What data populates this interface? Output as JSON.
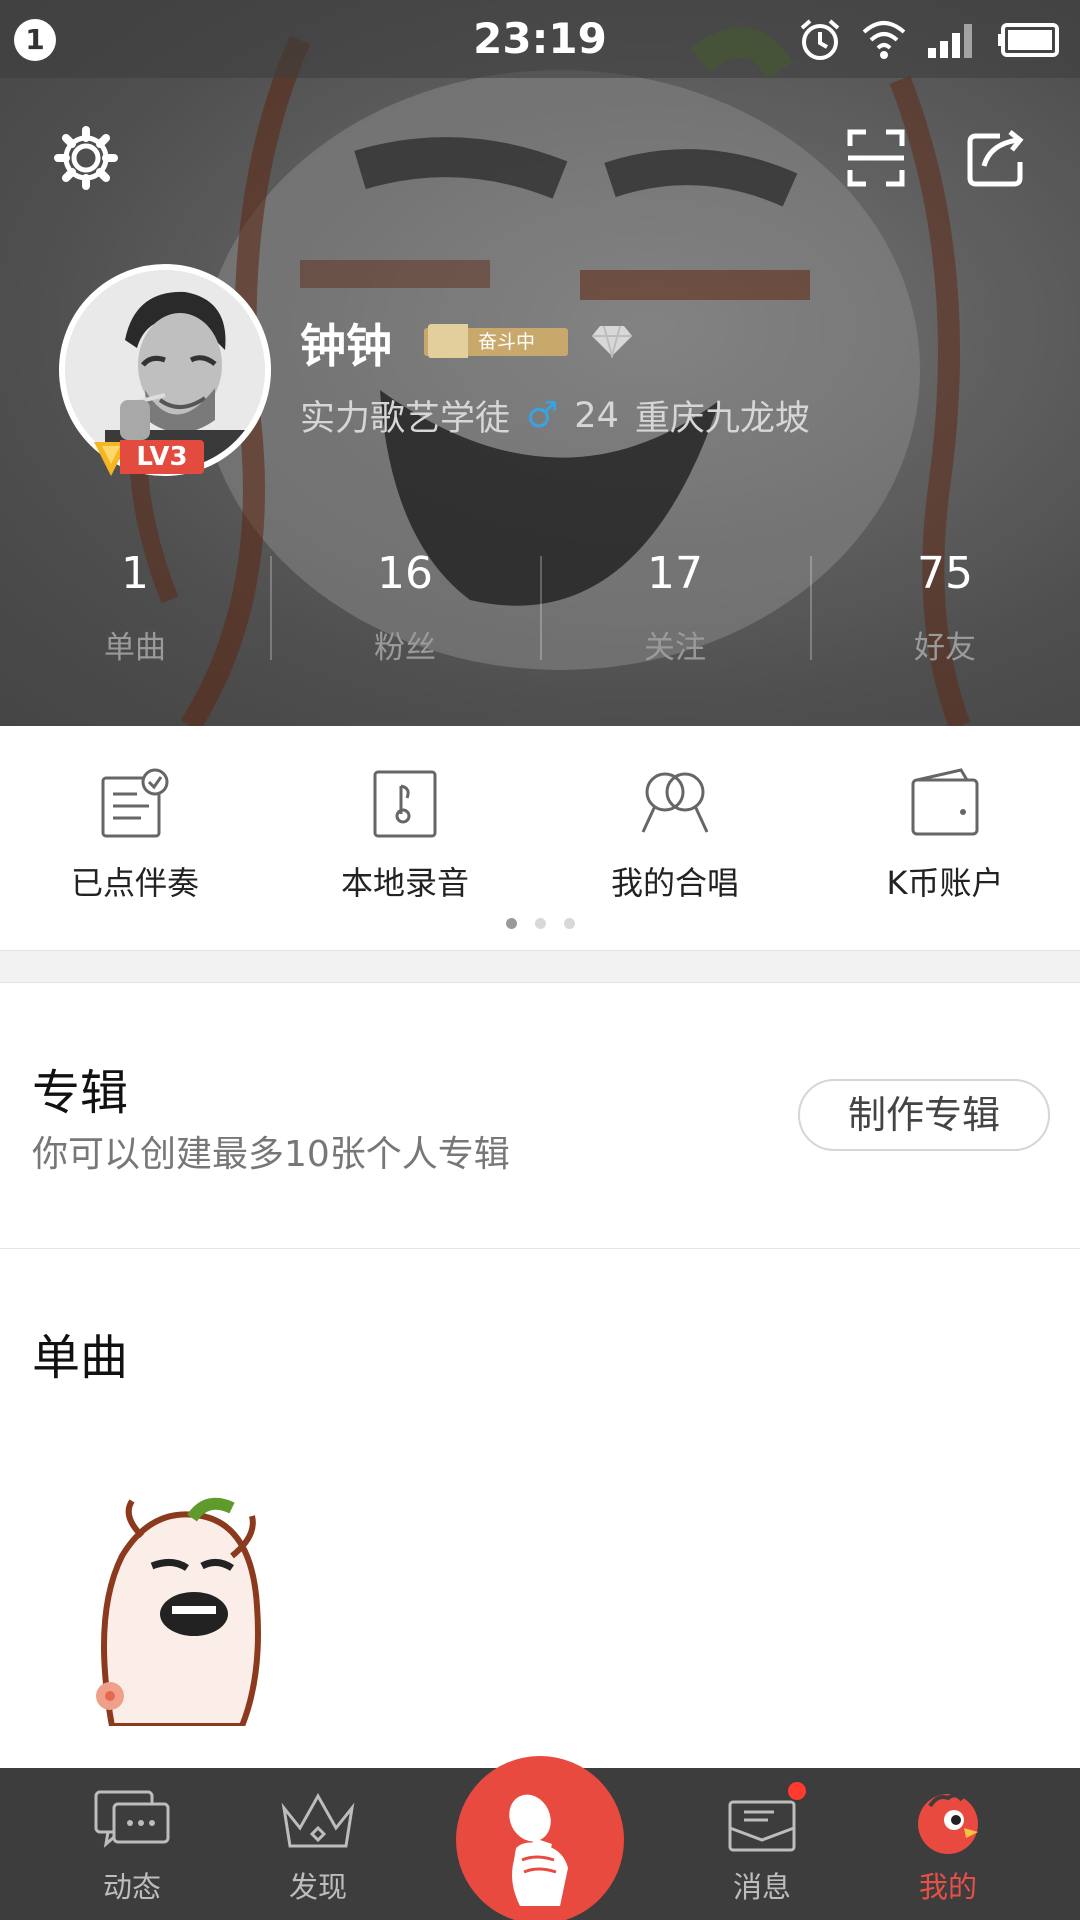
{
  "status_bar": {
    "notification_count": "1",
    "time": "23:19"
  },
  "profile": {
    "name": "钟钟",
    "status_tag": "奋斗中",
    "level": "LV3",
    "title": "实力歌艺学徒",
    "gender_symbol": "♂",
    "age": "24",
    "location": "重庆九龙坡"
  },
  "stats": [
    {
      "value": "1",
      "label": "单曲"
    },
    {
      "value": "16",
      "label": "粉丝"
    },
    {
      "value": "17",
      "label": "关注"
    },
    {
      "value": "75",
      "label": "好友"
    }
  ],
  "features": [
    {
      "label": "已点伴奏",
      "icon": "ordered-accompaniment-icon"
    },
    {
      "label": "本地录音",
      "icon": "local-recording-icon"
    },
    {
      "label": "我的合唱",
      "icon": "chorus-icon"
    },
    {
      "label": "K币账户",
      "icon": "wallet-icon"
    }
  ],
  "pager": {
    "pages": 3,
    "active": 0
  },
  "album": {
    "title": "专辑",
    "description": "你可以创建最多10张个人专辑",
    "create_button": "制作专辑"
  },
  "singles": {
    "title": "单曲"
  },
  "nav": [
    {
      "label": "动态",
      "icon": "chat-bubbles-icon"
    },
    {
      "label": "发现",
      "icon": "crown-icon"
    },
    {
      "label": "消息",
      "icon": "envelope-icon"
    },
    {
      "label": "我的",
      "icon": "bird-avatar-icon"
    }
  ],
  "colors": {
    "accent": "#e84a40",
    "nav_bg": "#3d3d3d",
    "gender": "#3aa2e0"
  }
}
